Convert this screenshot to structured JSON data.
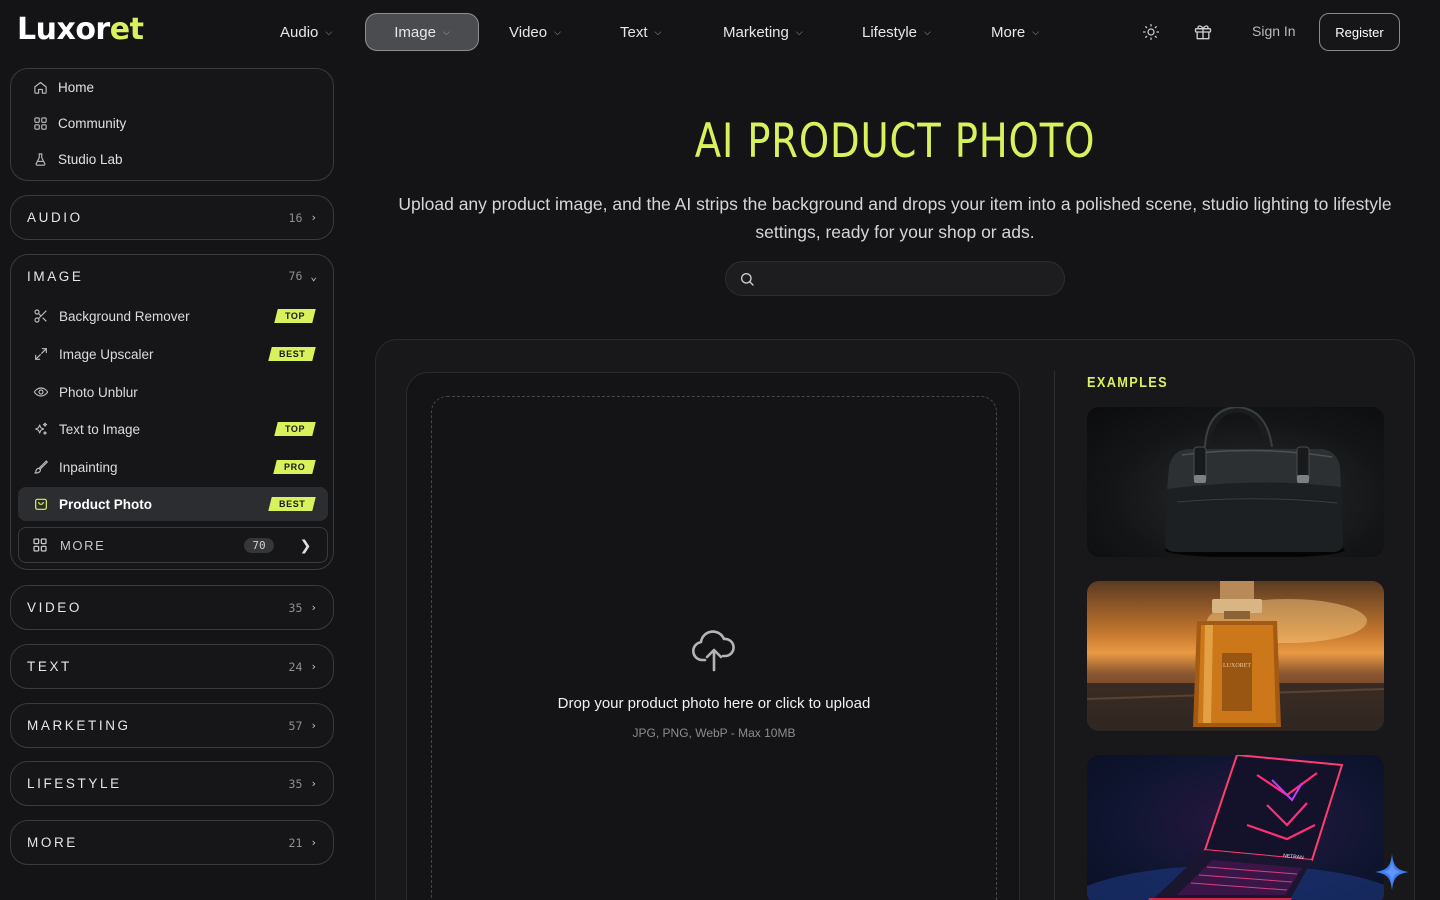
{
  "brand": {
    "name_main": "Luxor",
    "name_accent": "et"
  },
  "topnav": {
    "items": [
      {
        "label": "Audio"
      },
      {
        "label": "Image"
      },
      {
        "label": "Video"
      },
      {
        "label": "Text"
      },
      {
        "label": "Marketing"
      },
      {
        "label": "Lifestyle"
      },
      {
        "label": "More"
      }
    ],
    "active": "Image",
    "sign_in": "Sign In",
    "register": "Register"
  },
  "sidebar": {
    "primary": [
      {
        "label": "Home",
        "icon": "home-icon"
      },
      {
        "label": "Community",
        "icon": "grid-icon"
      },
      {
        "label": "Studio Lab",
        "icon": "flask-icon"
      }
    ],
    "categories": [
      {
        "title": "AUDIO",
        "count": "16",
        "expanded": false
      },
      {
        "title": "IMAGE",
        "count": "76",
        "expanded": true
      },
      {
        "title": "VIDEO",
        "count": "35",
        "expanded": false
      },
      {
        "title": "TEXT",
        "count": "24",
        "expanded": false
      },
      {
        "title": "MARKETING",
        "count": "57",
        "expanded": false
      },
      {
        "title": "LIFESTYLE",
        "count": "35",
        "expanded": false
      },
      {
        "title": "MORE",
        "count": "21",
        "expanded": false
      }
    ],
    "image_tools": [
      {
        "label": "Background Remover",
        "badge": "TOP",
        "icon": "scissors-icon"
      },
      {
        "label": "Image Upscaler",
        "badge": "BEST",
        "icon": "expand-icon"
      },
      {
        "label": "Photo Unblur",
        "badge": "",
        "icon": "eye-icon"
      },
      {
        "label": "Text to Image",
        "badge": "TOP",
        "icon": "sparkles-icon"
      },
      {
        "label": "Inpainting",
        "badge": "PRO",
        "icon": "brush-icon"
      },
      {
        "label": "Product Photo",
        "badge": "BEST",
        "icon": "bag-icon",
        "active": true
      }
    ],
    "more_tools": {
      "label": "MORE",
      "count": "70"
    }
  },
  "main": {
    "title": "AI PRODUCT PHOTO",
    "subtitle": "Upload any product image, and the AI strips the background and drops your item into a polished scene, studio lighting to lifestyle settings, ready for your shop or ads.",
    "search": {
      "placeholder": "",
      "value": ""
    },
    "upload": {
      "prompt": "Drop your product photo here or click to upload",
      "hint": "JPG, PNG, WebP - Max 10MB"
    },
    "examples": {
      "title": "EXAMPLES",
      "items": [
        {
          "subject": "black leather handbag"
        },
        {
          "subject": "perfume bottle at sunset"
        },
        {
          "subject": "gaming laptop with neon lights"
        }
      ]
    }
  },
  "colors": {
    "accent": "#d7f25c",
    "background": "#141416"
  }
}
